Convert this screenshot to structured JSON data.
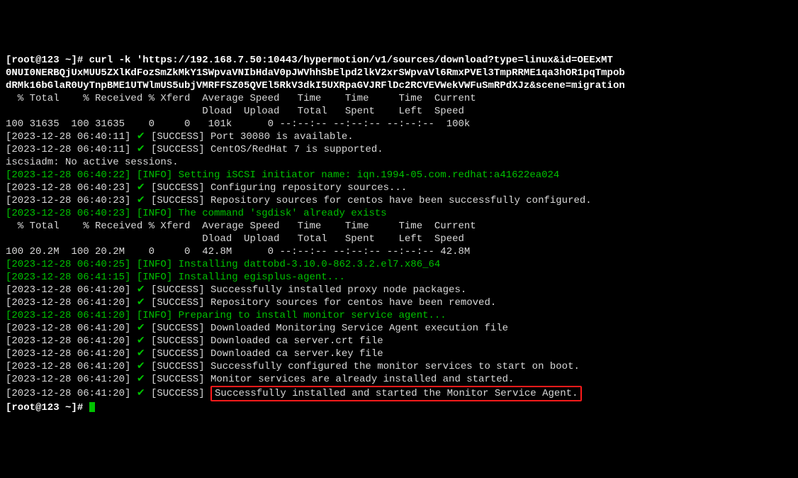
{
  "lines": [
    {
      "segs": [
        {
          "t": "[root@123 ~]# curl -k 'https://192.168.7.50:10443/hypermotion/v1/sources/download?type=linux&id=OEExMT",
          "c": "bold"
        }
      ]
    },
    {
      "segs": [
        {
          "t": "0NUI0NERBQjUxMUU5ZXlKdFozSmZkMkY1SWpvaVNIbHdaV0pJWVhhSbElpd2lkV2xrSWpvaVl6RmxPVEl3TmpRRME1qa3hOR1pqTmpob",
          "c": "bold"
        }
      ]
    },
    {
      "segs": [
        {
          "t": "dRMk16bGlaR0UyTnpBME1UTWlmUS5ubjVMRFFSZ05QVEl5RkV3dkI5UXRpaGVJRFlDc2RCVEVWekVWFuSmRPdXJz&scene=migration",
          "c": "bold"
        }
      ]
    },
    {
      "segs": [
        {
          "t": "  % Total    % Received % Xferd  Average Speed   Time    Time     Time  Current"
        }
      ]
    },
    {
      "segs": [
        {
          "t": "                                 Dload  Upload   Total   Spent    Left  Speed"
        }
      ]
    },
    {
      "segs": [
        {
          "t": "100 31635  100 31635    0     0   101k      0 --:--:-- --:--:-- --:--:--  100k"
        }
      ]
    },
    {
      "segs": [
        {
          "t": "[2023-12-28 06:40:11] "
        },
        {
          "t": "✔",
          "c": "green"
        },
        {
          "t": " [SUCCESS] Port 30080 is available."
        }
      ]
    },
    {
      "segs": [
        {
          "t": "[2023-12-28 06:40:11] "
        },
        {
          "t": "✔",
          "c": "green"
        },
        {
          "t": " [SUCCESS] CentOS/RedHat 7 is supported."
        }
      ]
    },
    {
      "segs": [
        {
          "t": "iscsiadm: No active sessions."
        }
      ]
    },
    {
      "segs": [
        {
          "t": "[2023-12-28 06:40:22] [INFO] Setting iSCSI initiator name: iqn.1994-05.com.redhat:a41622ea024",
          "c": "green"
        }
      ]
    },
    {
      "segs": [
        {
          "t": "[2023-12-28 06:40:23] "
        },
        {
          "t": "✔",
          "c": "green"
        },
        {
          "t": " [SUCCESS] Configuring repository sources..."
        }
      ]
    },
    {
      "segs": [
        {
          "t": "[2023-12-28 06:40:23] "
        },
        {
          "t": "✔",
          "c": "green"
        },
        {
          "t": " [SUCCESS] Repository sources for centos have been successfully configured."
        }
      ]
    },
    {
      "segs": [
        {
          "t": "[2023-12-28 06:40:23] [INFO] The command 'sgdisk' already exists",
          "c": "green"
        }
      ]
    },
    {
      "segs": [
        {
          "t": "  % Total    % Received % Xferd  Average Speed   Time    Time     Time  Current"
        }
      ]
    },
    {
      "segs": [
        {
          "t": "                                 Dload  Upload   Total   Spent    Left  Speed"
        }
      ]
    },
    {
      "segs": [
        {
          "t": "100 20.2M  100 20.2M    0     0  42.8M      0 --:--:-- --:--:-- --:--:-- 42.8M"
        }
      ]
    },
    {
      "segs": [
        {
          "t": "[2023-12-28 06:40:25] [INFO] Installing dattobd-3.10.0-862.3.2.el7.x86_64",
          "c": "green"
        }
      ]
    },
    {
      "segs": [
        {
          "t": "[2023-12-28 06:41:15] [INFO] Installing egisplus-agent...",
          "c": "green"
        }
      ]
    },
    {
      "segs": [
        {
          "t": "[2023-12-28 06:41:20] "
        },
        {
          "t": "✔",
          "c": "green"
        },
        {
          "t": " [SUCCESS] Successfully installed proxy node packages."
        }
      ]
    },
    {
      "segs": [
        {
          "t": "[2023-12-28 06:41:20] "
        },
        {
          "t": "✔",
          "c": "green"
        },
        {
          "t": " [SUCCESS] Repository sources for centos have been removed."
        }
      ]
    },
    {
      "segs": [
        {
          "t": "[2023-12-28 06:41:20] [INFO] Preparing to install monitor service agent...",
          "c": "green"
        }
      ]
    },
    {
      "segs": [
        {
          "t": "[2023-12-28 06:41:20] "
        },
        {
          "t": "✔",
          "c": "green"
        },
        {
          "t": " [SUCCESS] Downloaded Monitoring Service Agent execution file"
        }
      ]
    },
    {
      "segs": [
        {
          "t": "[2023-12-28 06:41:20] "
        },
        {
          "t": "✔",
          "c": "green"
        },
        {
          "t": " [SUCCESS] Downloaded ca server.crt file"
        }
      ]
    },
    {
      "segs": [
        {
          "t": "[2023-12-28 06:41:20] "
        },
        {
          "t": "✔",
          "c": "green"
        },
        {
          "t": " [SUCCESS] Downloaded ca server.key file"
        }
      ]
    },
    {
      "segs": [
        {
          "t": "[2023-12-28 06:41:20] "
        },
        {
          "t": "✔",
          "c": "green"
        },
        {
          "t": " [SUCCESS] Successfully configured the monitor services to start on boot."
        }
      ]
    },
    {
      "segs": [
        {
          "t": "[2023-12-28 06:41:20] "
        },
        {
          "t": "✔",
          "c": "green"
        },
        {
          "t": " [SUCCESS] Monitor services are already installed and started."
        }
      ]
    },
    {
      "segs": [
        {
          "t": "[2023-12-28 06:41:20] "
        },
        {
          "t": "✔",
          "c": "green"
        },
        {
          "t": " [SUCCESS] "
        },
        {
          "t": "Successfully installed and started the Monitor Service Agent.",
          "box": true
        }
      ]
    },
    {
      "segs": [
        {
          "t": "[root@123 ~]# ",
          "c": "bold"
        },
        {
          "cursor": true
        }
      ]
    }
  ]
}
